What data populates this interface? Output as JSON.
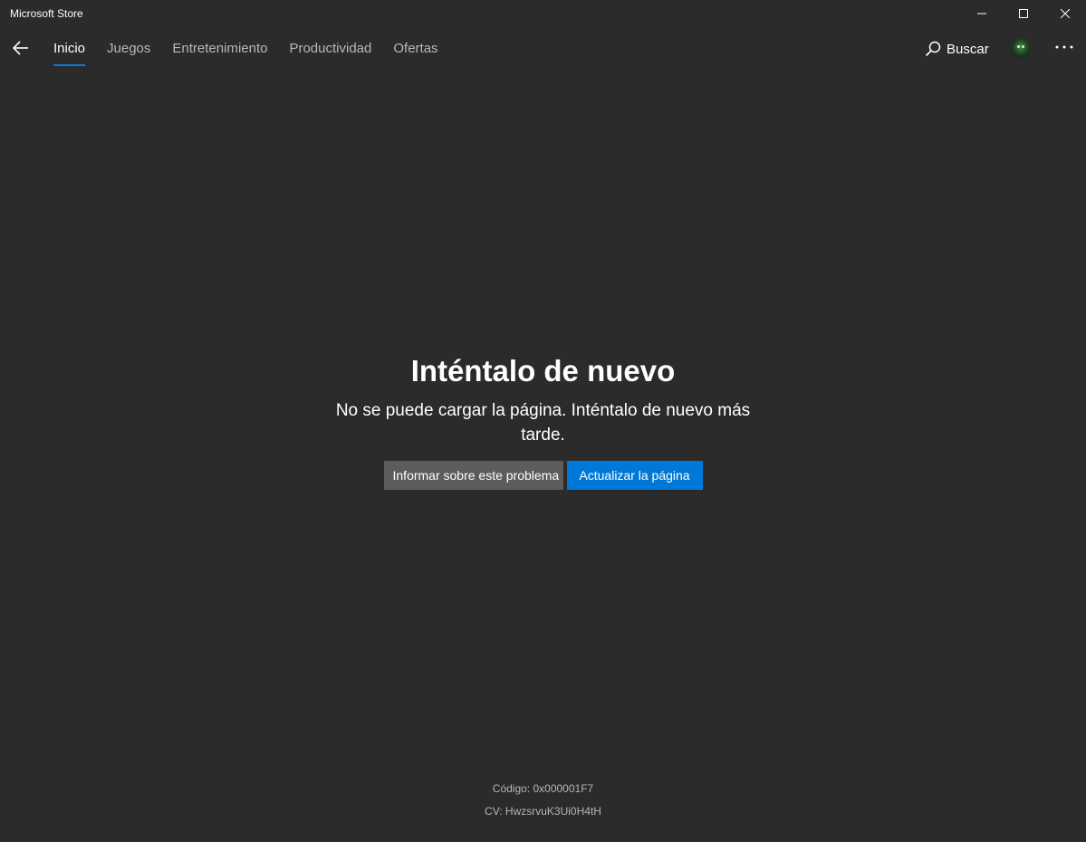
{
  "window": {
    "title": "Microsoft Store",
    "controls": [
      "minimize-icon",
      "maximize-icon",
      "close-icon"
    ]
  },
  "nav": {
    "back_icon": "back-arrow-icon",
    "tabs": [
      {
        "label": "Inicio",
        "active": true
      },
      {
        "label": "Juegos",
        "active": false
      },
      {
        "label": "Entretenimiento",
        "active": false
      },
      {
        "label": "Productividad",
        "active": false
      },
      {
        "label": "Ofertas",
        "active": false
      }
    ],
    "search_label": "Buscar",
    "search_icon": "search-icon",
    "more_icon": "more-icon"
  },
  "error": {
    "title": "Inténtalo de nuevo",
    "message": "No se puede cargar la página. Inténtalo de nuevo más tarde.",
    "report_button": "Informar sobre este problema",
    "refresh_button": "Actualizar la página"
  },
  "footer": {
    "code": "Código: 0x000001F7",
    "cv": "CV: HwzsrvuK3Ui0H4tH"
  },
  "colors": {
    "background": "#2b2b2b",
    "accent": "#0078d7",
    "secondary_button": "#5c5c5c",
    "inactive_tab": "#b8b8b8"
  }
}
